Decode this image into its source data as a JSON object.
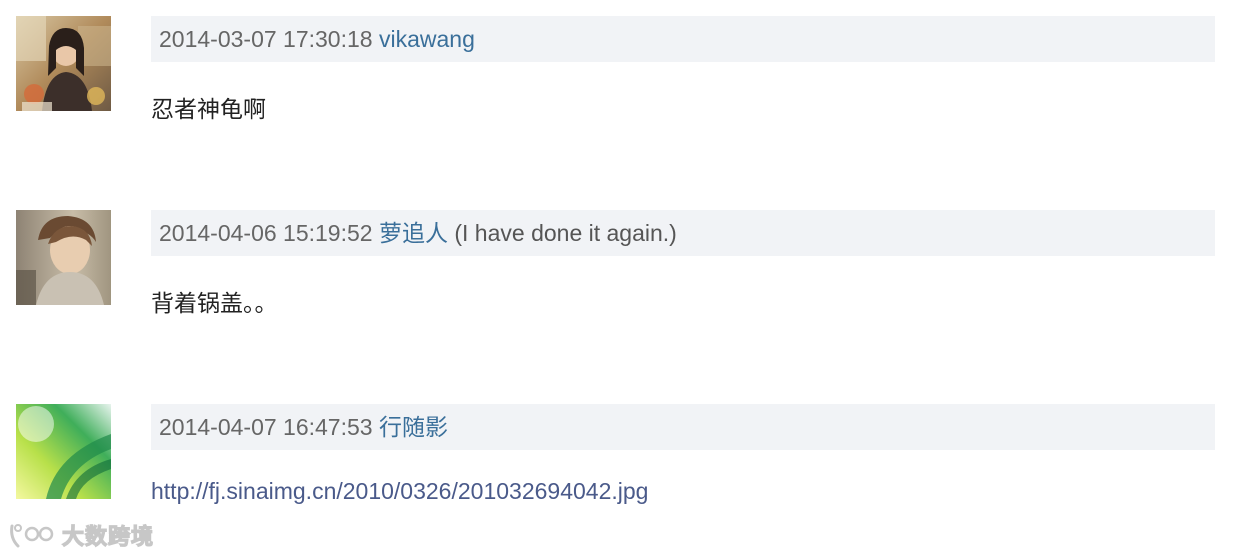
{
  "comments": [
    {
      "timestamp": "2014-03-07 17:30:18",
      "author": "vikawang",
      "signature": "",
      "body": "忍者神龟啊",
      "avatar_icon": "user-photo-avatar"
    },
    {
      "timestamp": "2014-04-06 15:19:52",
      "author": "萝追人",
      "signature": "(I have done it again.)",
      "body": "背着锅盖。。",
      "avatar_icon": "user-photo-avatar"
    },
    {
      "timestamp": "2014-04-07 16:47:53",
      "author": "行随影",
      "signature": "",
      "body": "http://fj.sinaimg.cn/2010/0326/201032694042.jpg",
      "avatar_icon": "abstract-green-avatar"
    }
  ],
  "watermark": {
    "text": "大数跨境"
  },
  "colors": {
    "meta_bg": "#f1f3f6",
    "author_link": "#3a6f9a",
    "url_link": "#4a5a8a"
  }
}
